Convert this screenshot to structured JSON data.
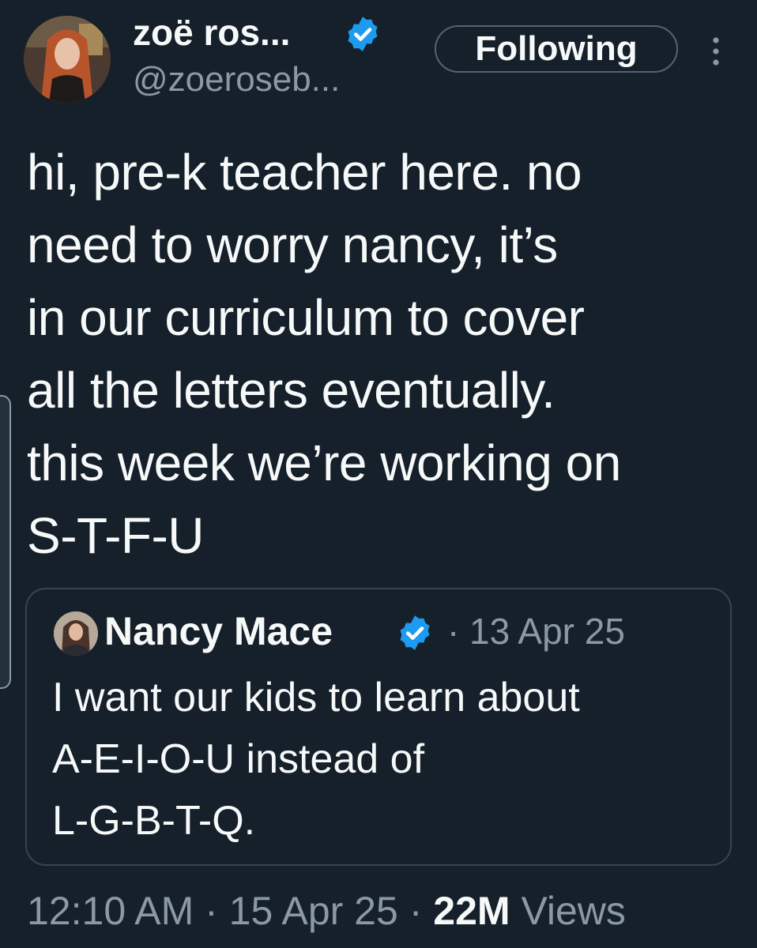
{
  "author": {
    "display_name": "zoë ros...",
    "handle": "@zoeroseb...",
    "verified": true
  },
  "follow_button": {
    "label": "Following"
  },
  "more_options_icon": "vertical-ellipsis-icon",
  "tweet": {
    "text": "hi, pre-k teacher here. no\nneed to worry nancy, it’s\nin our curriculum to cover\nall the letters eventually.\nthis week we’re working on\nS-T-F-U"
  },
  "quoted_tweet": {
    "author_name": "Nancy Mace",
    "verified": true,
    "separator": "·",
    "date": "13 Apr 25",
    "text": "I want our kids to learn about\nA-E-I-O-U instead of\nL-G-B-T-Q."
  },
  "meta": {
    "time": "12:10 AM",
    "separator": "·",
    "date": "15 Apr 25",
    "views_count": "22M",
    "views_label": "Views"
  },
  "colors": {
    "background": "#15202b",
    "text_primary": "#f7f9f9",
    "text_secondary": "#8b98a5",
    "verified_blue": "#1d9bf0",
    "border": "#38444d"
  }
}
